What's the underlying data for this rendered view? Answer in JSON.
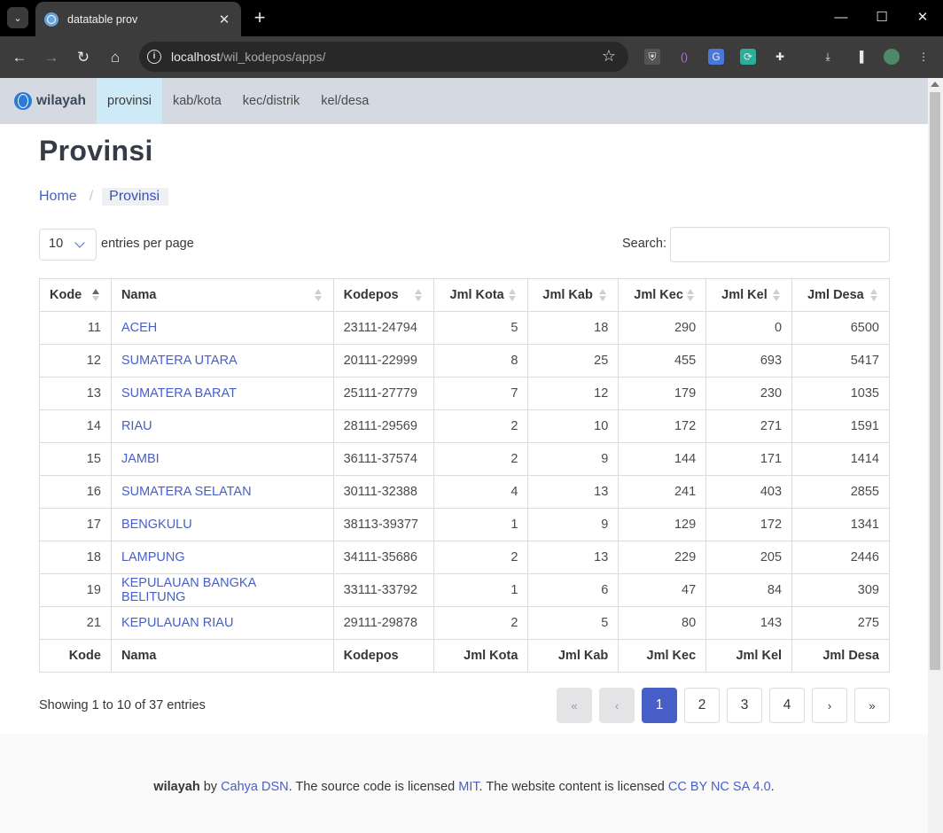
{
  "browser": {
    "tab_title": "datatable prov",
    "tab_close": "✕",
    "new_tab": "+",
    "url_host": "localhost",
    "url_path": "/wil_kodepos/apps/",
    "window_controls": [
      "—",
      "☐",
      "✕"
    ],
    "extension_icons": [
      "shield-icon",
      "code-icon",
      "translate-icon",
      "sync-icon",
      "puzzle-icon",
      "download-icon",
      "sidepanel-icon",
      "profile-icon",
      "kebab-icon"
    ]
  },
  "site": {
    "brand": "wilayah",
    "nav": [
      {
        "label": "provinsi",
        "active": true
      },
      {
        "label": "kab/kota",
        "active": false
      },
      {
        "label": "kec/distrik",
        "active": false
      },
      {
        "label": "kel/desa",
        "active": false
      }
    ]
  },
  "page": {
    "title": "Provinsi",
    "breadcrumb": {
      "home": "Home",
      "current": "Provinsi"
    }
  },
  "datatable": {
    "per_page_value": "10",
    "per_page_label": "entries per page",
    "search_label": "Search:",
    "search_value": "",
    "columns": [
      "Kode",
      "Nama",
      "Kodepos",
      "Jml Kota",
      "Jml Kab",
      "Jml Kec",
      "Jml Kel",
      "Jml Desa"
    ],
    "sorted_column": "Kode",
    "sort_direction": "asc",
    "rows": [
      [
        "11",
        "ACEH",
        "23111-24794",
        "5",
        "18",
        "290",
        "0",
        "6500"
      ],
      [
        "12",
        "SUMATERA UTARA",
        "20111-22999",
        "8",
        "25",
        "455",
        "693",
        "5417"
      ],
      [
        "13",
        "SUMATERA BARAT",
        "25111-27779",
        "7",
        "12",
        "179",
        "230",
        "1035"
      ],
      [
        "14",
        "RIAU",
        "28111-29569",
        "2",
        "10",
        "172",
        "271",
        "1591"
      ],
      [
        "15",
        "JAMBI",
        "36111-37574",
        "2",
        "9",
        "144",
        "171",
        "1414"
      ],
      [
        "16",
        "SUMATERA SELATAN",
        "30111-32388",
        "4",
        "13",
        "241",
        "403",
        "2855"
      ],
      [
        "17",
        "BENGKULU",
        "38113-39377",
        "1",
        "9",
        "129",
        "172",
        "1341"
      ],
      [
        "18",
        "LAMPUNG",
        "34111-35686",
        "2",
        "13",
        "229",
        "205",
        "2446"
      ],
      [
        "19",
        "KEPULAUAN BANGKA BELITUNG",
        "33111-33792",
        "1",
        "6",
        "47",
        "84",
        "309"
      ],
      [
        "21",
        "KEPULAUAN RIAU",
        "29111-29878",
        "2",
        "5",
        "80",
        "143",
        "275"
      ]
    ],
    "info": "Showing 1 to 10 of 37 entries",
    "pagination": {
      "first": "«",
      "prev": "‹",
      "next": "›",
      "last": "»",
      "pages": [
        "1",
        "2",
        "3",
        "4"
      ],
      "current": "1"
    }
  },
  "footer": {
    "brand": "wilayah",
    "by": " by ",
    "author": "Cahya DSN",
    "code_text": ". The source code is licensed ",
    "code_license": "MIT",
    "content_text": ". The website content is licensed ",
    "content_license": "CC BY NC SA 4.0",
    "end": "."
  },
  "colors": {
    "link": "#485fc7",
    "nav_bg": "#d5dae2",
    "nav_active_bg": "#cfeaf7",
    "page_current": "#485fc7"
  }
}
